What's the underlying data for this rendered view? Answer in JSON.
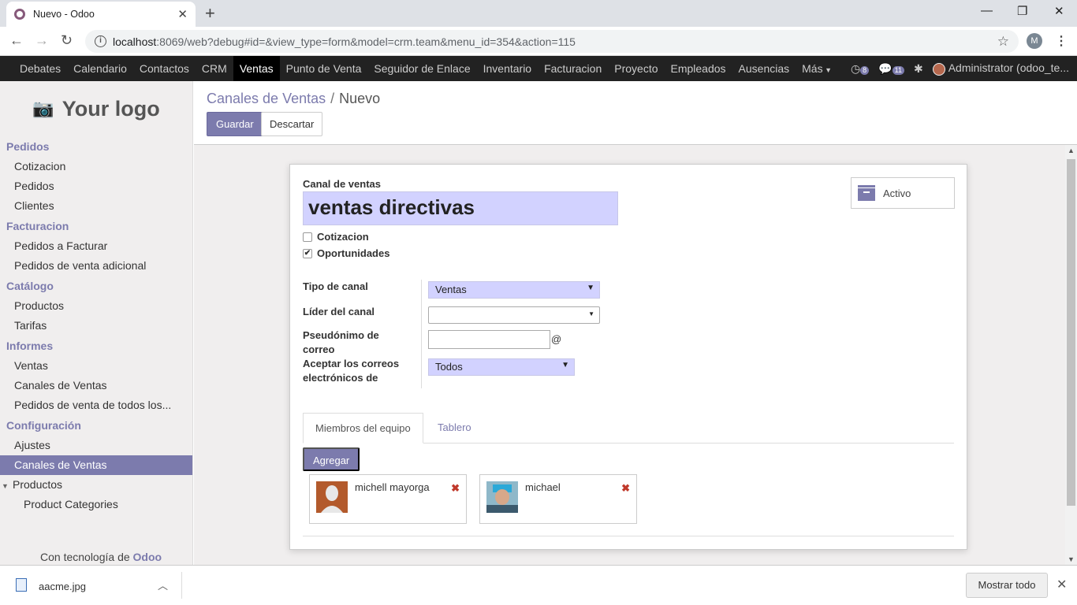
{
  "browser": {
    "tab_title": "Nuevo - Odoo",
    "url_host": "localhost",
    "url_rest": ":8069/web?debug#id=&view_type=form&model=crm.team&menu_id=354&action=115",
    "profile_initial": "M"
  },
  "topnav": {
    "items": [
      "Debates",
      "Calendario",
      "Contactos",
      "CRM",
      "Ventas",
      "Punto de Venta",
      "Seguidor de Enlace",
      "Inventario",
      "Facturacion",
      "Proyecto",
      "Empleados",
      "Ausencias",
      "Más"
    ],
    "active": "Ventas",
    "activity_count": "8",
    "messages_count": "11",
    "user": "Administrator (odoo_te..."
  },
  "sidebar": {
    "logo_text": "Your logo",
    "sections": [
      {
        "header": "Pedidos",
        "items": [
          "Cotizacion",
          "Pedidos",
          "Clientes"
        ]
      },
      {
        "header": "Facturacion",
        "items": [
          "Pedidos a Facturar",
          "Pedidos de venta adicional"
        ]
      },
      {
        "header": "Catálogo",
        "items": [
          "Productos",
          "Tarifas"
        ]
      },
      {
        "header": "Informes",
        "items": [
          "Ventas",
          "Canales de Ventas",
          "Pedidos de venta de todos los..."
        ]
      },
      {
        "header": "Configuración",
        "items": [
          "Ajustes",
          "Canales de Ventas",
          "Productos",
          "Product Categories"
        ]
      }
    ],
    "footer_prefix": "Con tecnología de",
    "footer_brand": "Odoo"
  },
  "control": {
    "breadcrumb_parent": "Canales de Ventas",
    "breadcrumb_sep": "/",
    "breadcrumb_current": "Nuevo",
    "save_label": "Guardar",
    "discard_label": "Descartar"
  },
  "form": {
    "name_label": "Canal de ventas",
    "name_value": "ventas directivas",
    "active_label": "Activo",
    "cb_cotizacion": "Cotizacion",
    "cb_cotizacion_checked": false,
    "cb_oportunidades": "Oportunidades",
    "cb_oportunidades_checked": true,
    "tipo_label": "Tipo de canal",
    "tipo_value": "Ventas",
    "lider_label": "Líder del canal",
    "lider_value": "",
    "alias_label": "Pseudónimo de correo",
    "alias_suffix": "@",
    "aceptar_label": "Aceptar los correos electrónicos de",
    "aceptar_value": "Todos",
    "tabs": [
      "Miembros del equipo",
      "Tablero"
    ],
    "add_label": "Agregar",
    "members": [
      {
        "name": "michell mayorga"
      },
      {
        "name": "michael"
      }
    ]
  },
  "downloads": {
    "file": "aacme.jpg",
    "show_all": "Mostrar todo"
  },
  "colors": {
    "brand": "#7c7bad",
    "required_field": "#d2d2ff",
    "nav_bg": "#222222"
  }
}
